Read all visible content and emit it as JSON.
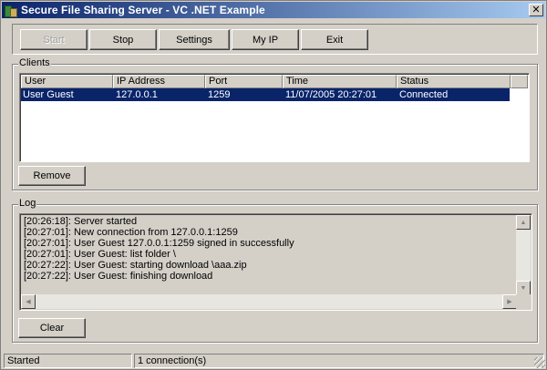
{
  "window": {
    "title": "Secure File Sharing Server - VC .NET Example",
    "close_glyph": "✕"
  },
  "toolbar": {
    "start_label": "Start",
    "stop_label": "Stop",
    "settings_label": "Settings",
    "myip_label": "My IP",
    "exit_label": "Exit"
  },
  "clients": {
    "group_label": "Clients",
    "columns": [
      "User",
      "IP Address",
      "Port",
      "Time",
      "Status"
    ],
    "rows": [
      {
        "user": "User Guest",
        "ip": "127.0.0.1",
        "port": "1259",
        "time": "11/07/2005 20:27:01",
        "status": "Connected"
      }
    ],
    "remove_label": "Remove"
  },
  "log": {
    "group_label": "Log",
    "lines": [
      "[20:26:18]: Server started",
      "[20:27:01]: New connection from 127.0.0.1:1259",
      "[20:27:01]: User Guest 127.0.0.1:1259 signed in successfully",
      "[20:27:01]: User Guest: list folder \\",
      "[20:27:22]: User Guest: starting download \\aaa.zip",
      "[20:27:22]: User Guest: finishing download"
    ],
    "clear_label": "Clear"
  },
  "status": {
    "state": "Started",
    "connections": "1 connection(s)"
  },
  "colors": {
    "title_start": "#0a246a",
    "title_end": "#a6caf0",
    "selection": "#0a246a",
    "face": "#d4d0c8"
  }
}
